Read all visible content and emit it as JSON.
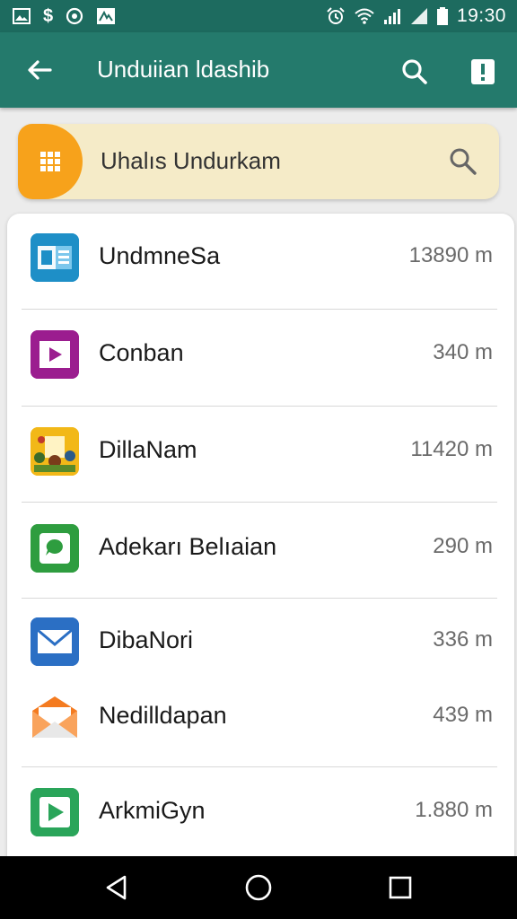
{
  "status_bar": {
    "time": "19:30",
    "left_icons": [
      "gallery-icon",
      "dollar-icon",
      "sync-circle-icon",
      "app-notification-icon"
    ],
    "right_icons": [
      "alarm-icon",
      "wifi-icon",
      "signal-icon",
      "signal-icon",
      "battery-icon"
    ]
  },
  "app_bar": {
    "title": "Unduiian ldashib",
    "back_icon": "arrow-back-icon",
    "search_icon": "search-icon",
    "more_icon": "alert-icon"
  },
  "search_card": {
    "text": "Uhalıs Undurkam",
    "badge_icon": "grid-icon",
    "search_icon": "search-icon"
  },
  "apps": [
    {
      "name": "UndmneSa",
      "size": "13890 m",
      "icon": "word-doc-icon",
      "color": "#1e8fc7"
    },
    {
      "name": "Conban",
      "size": "340 m",
      "icon": "play-video-icon",
      "color": "#9b1d8f"
    },
    {
      "name": "DillaNam",
      "size": "11420 m",
      "icon": "game-icon",
      "color": "#f2b818"
    },
    {
      "name": "Adekarı Belıaian",
      "size": "290 m",
      "icon": "chat-bubble-icon",
      "color": "#2e9d3f"
    },
    {
      "name": "DibaNori",
      "size": "336 m",
      "icon": "mail-icon",
      "color": "#2b6fc4"
    },
    {
      "name": "Nedilldapan",
      "size": "439 m",
      "icon": "envelope-icon",
      "color": "#f47b20"
    },
    {
      "name": "ArkmiGyn",
      "size": "1.880 m",
      "icon": "play-store-icon",
      "color": "#2aa55a"
    }
  ],
  "nav_bar": {
    "back_icon": "nav-back-icon",
    "home_icon": "nav-home-icon",
    "recents_icon": "nav-recents-icon"
  }
}
